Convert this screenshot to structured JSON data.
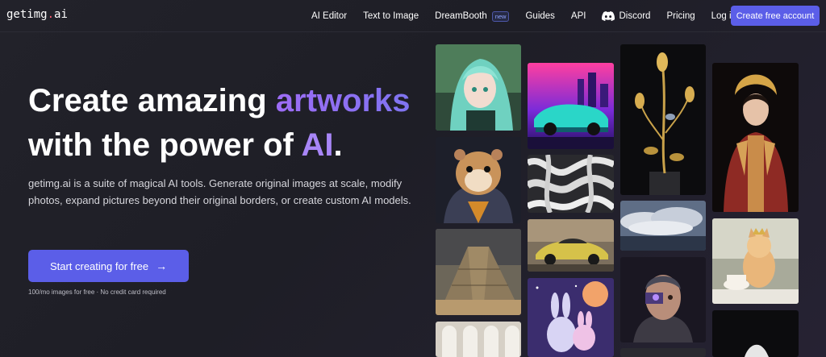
{
  "brand": {
    "name_main": "getimg",
    "name_dot": ".",
    "name_tld": "ai"
  },
  "nav": {
    "items": [
      {
        "label": "AI Editor"
      },
      {
        "label": "Text to Image"
      },
      {
        "label": "DreamBooth",
        "badge": "new"
      },
      {
        "label": "Guides"
      },
      {
        "label": "API"
      },
      {
        "label": "Discord",
        "icon": "discord-icon"
      },
      {
        "label": "Pricing"
      },
      {
        "label": "Log in"
      }
    ],
    "cta": "Create free account"
  },
  "hero": {
    "title_line1_part1": "Create amazing ",
    "title_line1_highlight": "artworks",
    "title_line2_part1": "with the power of ",
    "title_line2_highlight": "AI",
    "title_line2_end": ".",
    "description": "getimg.ai is a suite of magical AI tools. Generate original images at scale, modify photos, expand pictures beyond their original borders, or create custom AI models.",
    "button_label": "Start creating for free",
    "button_icon": "arrow-right-icon",
    "note": "100/mo images for free · No credit card required"
  },
  "gallery": {
    "images": [
      "anime-girl-image",
      "hamster-astronaut-image",
      "pyramid-image",
      "arched-windows-image",
      "neon-car-image",
      "white-pattern-image",
      "yellow-sportscar-image",
      "bunny-cartoon-image",
      "golden-flowers-image",
      "clouds-seascape-image",
      "cyborg-portrait-image",
      "dark-tile-image",
      "asian-queen-image",
      "cat-teacup-image",
      "dark-scene-image"
    ]
  },
  "colors": {
    "accent": "#5b5ee8",
    "highlight": "#9d6cf5",
    "background": "#22222a",
    "logo_dot": "#ff5a6e"
  }
}
